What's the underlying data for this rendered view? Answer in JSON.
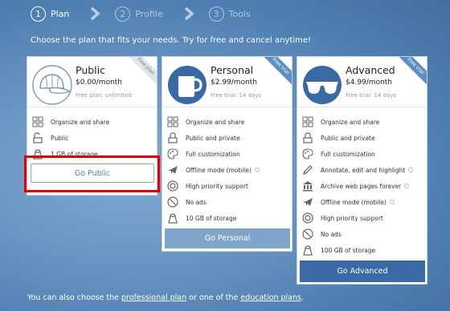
{
  "steps": [
    {
      "number": "1",
      "label": "Plan"
    },
    {
      "number": "2",
      "label": "Profile"
    },
    {
      "number": "3",
      "label": "Tools"
    }
  ],
  "tagline": "Choose the plan that fits your needs. Try for free and cancel anytime!",
  "plans": [
    {
      "name": "Public",
      "price": "$0.00/month",
      "note": "Free plan: unlimited",
      "ribbon": "Free plan",
      "icon": "baseball-cap-icon",
      "features": [
        {
          "icon": "organize-grid-icon",
          "label": "Organize and share"
        },
        {
          "icon": "open-padlock-icon",
          "label": "Public"
        },
        {
          "icon": "storage-weight-icon",
          "label": "1 GB of storage"
        }
      ],
      "button": "Go Public"
    },
    {
      "name": "Personal",
      "price": "$2.99/month",
      "note": "Free trial: 14 days",
      "ribbon": "Free trial",
      "icon": "mug-icon",
      "features": [
        {
          "icon": "organize-grid-icon",
          "label": "Organize and share"
        },
        {
          "icon": "padlock-icon",
          "label": "Public and private"
        },
        {
          "icon": "palette-brush-icon",
          "label": "Full customization"
        },
        {
          "icon": "airplane-icon",
          "label": "Offline mode (mobile)"
        },
        {
          "icon": "lifebuoy-icon",
          "label": "High priority support"
        },
        {
          "icon": "no-ads-icon",
          "label": "No ads"
        },
        {
          "icon": "storage-weight-icon",
          "label": "10 GB of storage"
        }
      ],
      "button": "Go Personal"
    },
    {
      "name": "Advanced",
      "price": "$4.99/month",
      "note": "Free trial: 14 days",
      "ribbon": "Free trial",
      "icon": "sunglasses-icon",
      "features": [
        {
          "icon": "organize-grid-icon",
          "label": "Organize and share"
        },
        {
          "icon": "padlock-icon",
          "label": "Public and private"
        },
        {
          "icon": "palette-brush-icon",
          "label": "Full customization"
        },
        {
          "icon": "pencil-icon",
          "label": "Annotate, edit and highlight"
        },
        {
          "icon": "archive-building-icon",
          "label": "Archive web pages forever"
        },
        {
          "icon": "airplane-icon",
          "label": "Offline mode (mobile)"
        },
        {
          "icon": "lifebuoy-icon",
          "label": "High priority support"
        },
        {
          "icon": "no-ads-icon",
          "label": "No ads"
        },
        {
          "icon": "storage-weight-icon",
          "label": "100 GB of storage"
        }
      ],
      "button": "Go Advanced"
    }
  ],
  "footer": {
    "prefix": "You can also choose the ",
    "link1": "professional plan",
    "middle": " or one of the ",
    "link2": "education plans",
    "suffix": "."
  },
  "colors": {
    "primary_button": "#3a6aa5",
    "accent": "#5e8fc4",
    "highlight_box": "#e10000"
  }
}
